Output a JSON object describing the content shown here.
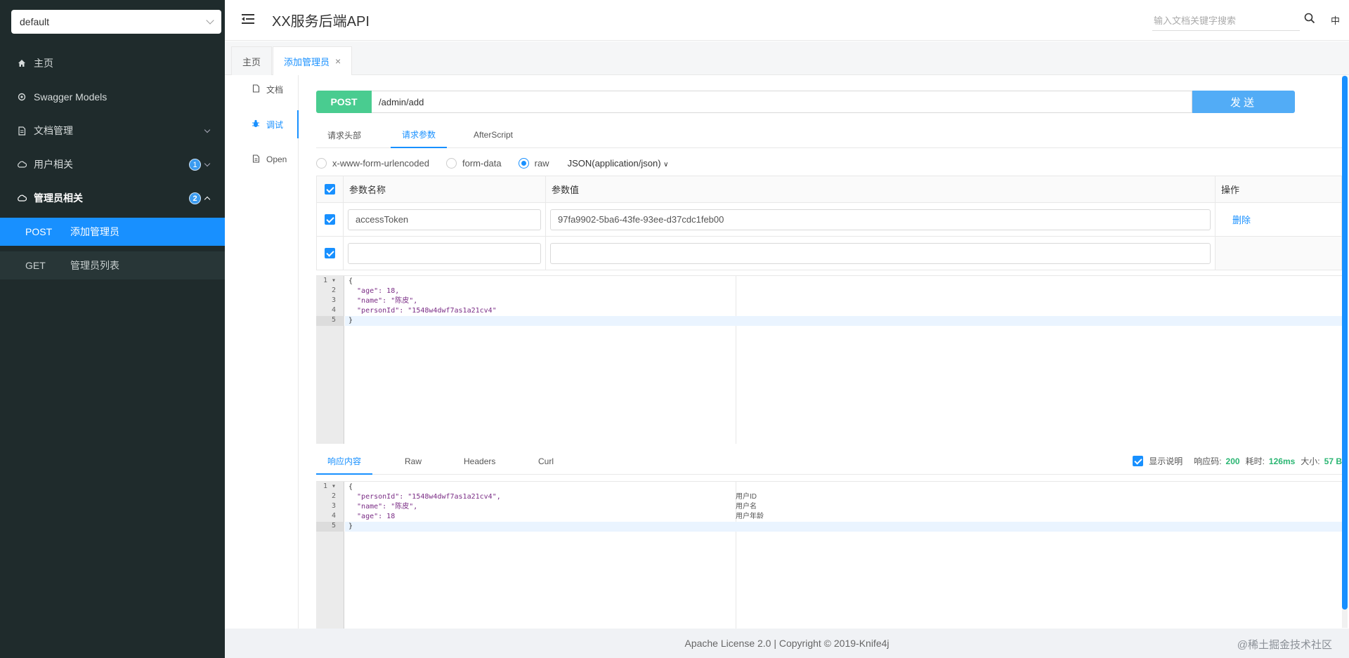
{
  "sidebar": {
    "group_select": "default",
    "items": [
      {
        "label": "主页",
        "icon": "home-icon"
      },
      {
        "label": "Swagger Models",
        "icon": "settings-icon"
      },
      {
        "label": "文档管理",
        "icon": "doc-icon"
      },
      {
        "label": "用户相关",
        "icon": "cloud-icon",
        "badge": "1"
      },
      {
        "label": "管理员相关",
        "icon": "cloud-icon",
        "badge": "2"
      }
    ],
    "sub_items": [
      {
        "method": "POST",
        "label": "添加管理员"
      },
      {
        "method": "GET",
        "label": "管理员列表"
      }
    ]
  },
  "header": {
    "title": "XX服务后端API",
    "search_placeholder": "输入文档关键字搜索",
    "lang": "中"
  },
  "tabs": [
    {
      "label": "主页"
    },
    {
      "label": "添加管理员",
      "close": "×"
    }
  ],
  "mini_nav": [
    {
      "label": "文档"
    },
    {
      "label": "调试"
    },
    {
      "label": "Open"
    }
  ],
  "request": {
    "method": "POST",
    "url": "/admin/add",
    "send_label": "发送",
    "tabs": [
      "请求头部",
      "请求参数",
      "AfterScript"
    ],
    "body_types": [
      "x-www-form-urlencoded",
      "form-data",
      "raw"
    ],
    "content_type": "JSON(application/json)",
    "table": {
      "headers": [
        "参数名称",
        "参数值",
        "操作"
      ],
      "rows": [
        {
          "name": "accessToken",
          "value": "97fa9902-5ba6-43fe-93ee-d37cdc1feb00",
          "action": "删除"
        }
      ]
    },
    "body_lines": [
      "{",
      "  \"age\": 18,",
      "  \"name\": \"陈皮\",",
      "  \"personId\": \"1548w4dwf7as1a21cv4\"",
      "}"
    ]
  },
  "response": {
    "tabs": [
      "响应内容",
      "Raw",
      "Headers",
      "Curl"
    ],
    "show_desc": "显示说明",
    "code_label": "响应码:",
    "code": "200",
    "time_label": "耗时:",
    "time": "126ms",
    "size_label": "大小:",
    "size": "57 B",
    "body_lines": [
      "{",
      "  \"personId\": \"1548w4dwf7as1a21cv4\",",
      "  \"name\": \"陈皮\",",
      "  \"age\": 18",
      "}"
    ],
    "comments": [
      "用户ID",
      "用户名",
      "用户年龄"
    ]
  },
  "footer": {
    "text": "Apache License 2.0 | Copyright © 2019-Knife4j",
    "watermark": "@稀土掘金技术社区"
  }
}
